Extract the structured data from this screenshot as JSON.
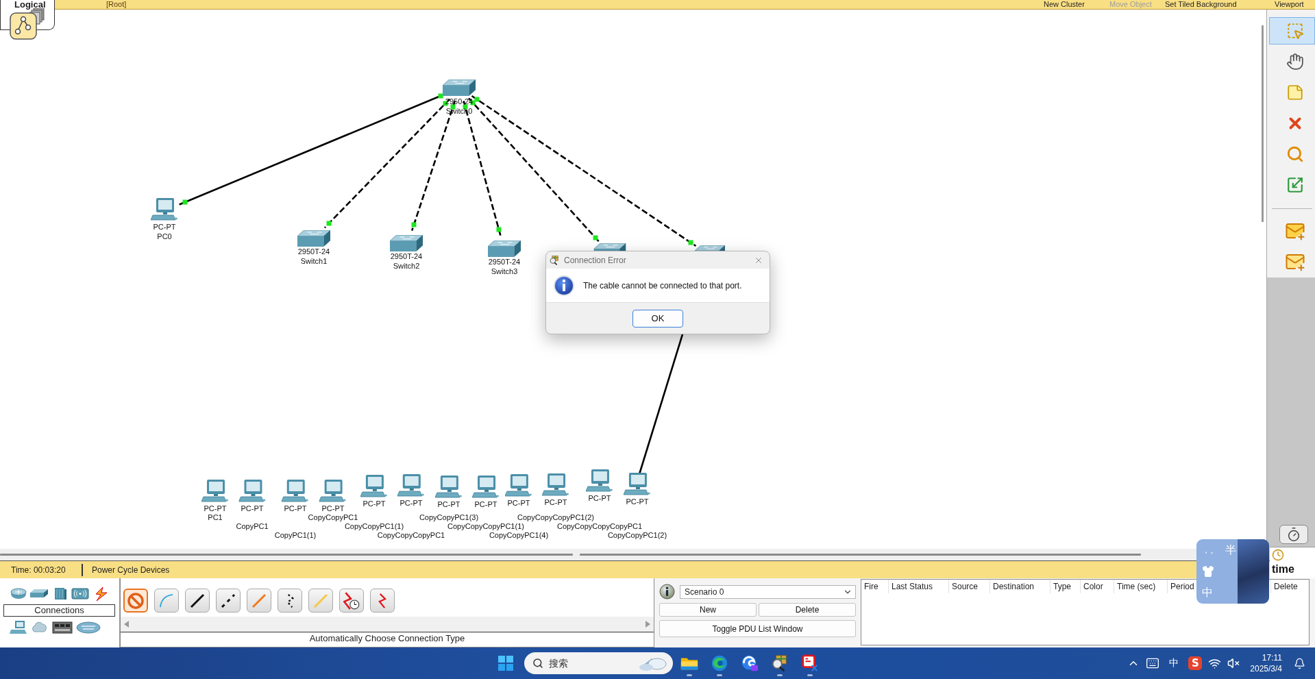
{
  "top_bar": {
    "view_tab": {
      "label": "Logical",
      "selected": true
    },
    "path": "[Root]",
    "actions": [
      {
        "label": "New Cluster",
        "disabled": false
      },
      {
        "label": "Move Object",
        "disabled": true
      },
      {
        "label": "Set Tiled Background",
        "disabled": false
      },
      {
        "label": "Viewport",
        "disabled": false
      }
    ]
  },
  "devices": [
    {
      "kind": "switch",
      "model": "2950-24",
      "name": "Switch0"
    },
    {
      "kind": "pc",
      "model": "PC-PT",
      "name": "PC0"
    },
    {
      "kind": "switch",
      "model": "2950T-24",
      "name": "Switch1"
    },
    {
      "kind": "switch",
      "model": "2950T-24",
      "name": "Switch2"
    },
    {
      "kind": "switch",
      "model": "2950T-24",
      "name": "Switch3"
    },
    {
      "kind": "switch"
    },
    {
      "kind": "switch"
    },
    {
      "kind": "pc",
      "model": "PC-PT",
      "name": "PC1"
    },
    {
      "kind": "pc",
      "model": "PC-PT",
      "name": "CopyPC1"
    },
    {
      "kind": "pc",
      "model": "PC-PT",
      "name": "CopyPC1(1)"
    },
    {
      "kind": "pc",
      "model": "PC-PT",
      "name": "CopyCopyPC1"
    },
    {
      "kind": "pc",
      "model": "PC-PT",
      "name": "CopyCopyPC1(1)"
    },
    {
      "kind": "pc",
      "model": "PC-PT",
      "name": "CopyCopyCopyPC1"
    },
    {
      "kind": "pc",
      "model": "PC-PT",
      "name": "CopyCopyPC1(3)"
    },
    {
      "kind": "pc",
      "model": "PC-PT",
      "name": "CopyCopyCopyPC1(1)"
    },
    {
      "kind": "pc",
      "model": "PC-PT",
      "name": "CopyCopyPC1(4)"
    },
    {
      "kind": "pc",
      "model": "PC-PT",
      "name": "CopyCopyCopyPC1(2)"
    },
    {
      "kind": "pc",
      "model": "PC-PT",
      "name": "CopyCopyCopyCopyPC1"
    },
    {
      "kind": "pc",
      "model": "PC-PT",
      "name": "CopyCopyPC1(2)"
    }
  ],
  "cables": [
    {
      "kind": "straight",
      "link_up": true
    },
    {
      "kind": "cross",
      "link_up": true
    },
    {
      "kind": "cross",
      "link_up": true
    },
    {
      "kind": "cross",
      "link_up": true
    },
    {
      "kind": "cross",
      "link_up": true
    },
    {
      "kind": "cross",
      "link_up": true
    },
    {
      "kind": "straight",
      "link_up": false
    }
  ],
  "dialog": {
    "title": "Connection Error",
    "message": "The cable cannot be connected to that port.",
    "button": "OK"
  },
  "right_toolbar": {
    "tools": [
      {
        "kind": "select",
        "selected": true
      },
      {
        "kind": "move",
        "selected": false
      },
      {
        "kind": "note",
        "selected": false
      },
      {
        "kind": "delete",
        "selected": false
      },
      {
        "kind": "inspect",
        "selected": false
      },
      {
        "kind": "resize",
        "selected": false
      }
    ],
    "pdu_tools": [
      {
        "kind": "simple-pdu",
        "selected": false
      },
      {
        "kind": "complex-pdu",
        "selected": false
      }
    ]
  },
  "status_bar": {
    "time": "Time: 00:03:20",
    "action": "Power Cycle Devices",
    "mode_tab": "time"
  },
  "device_panel": {
    "category_label": "Connections"
  },
  "connection_panel": {
    "types": [
      {
        "kind": "auto",
        "selected": true
      },
      {
        "kind": "console",
        "selected": false
      },
      {
        "kind": "straight",
        "selected": false
      },
      {
        "kind": "cross",
        "selected": false
      },
      {
        "kind": "fiber",
        "selected": false
      },
      {
        "kind": "phone",
        "selected": false
      },
      {
        "kind": "coaxial",
        "selected": false
      },
      {
        "kind": "serial-dce",
        "selected": false
      },
      {
        "kind": "serial-dte",
        "selected": false
      }
    ],
    "description": "Automatically Choose Connection Type"
  },
  "scenario_panel": {
    "scenario": "Scenario 0",
    "buttons": [
      "New",
      "Delete"
    ],
    "toggle_button": "Toggle PDU List Window"
  },
  "pdu_table": {
    "columns": [
      "Fire",
      "Last Status",
      "Source",
      "Destination",
      "Type",
      "Color",
      "Time (sec)",
      "Period",
      "Delete"
    ]
  },
  "ime_toolbar": {
    "punctuation": "，。",
    "width_mode": "半",
    "language": "中"
  },
  "taskbar": {
    "search": {
      "placeholder": "搜索"
    },
    "apps": [
      {
        "kind": "folder",
        "running": true
      },
      {
        "kind": "edge",
        "running": true
      },
      {
        "kind": "edge-ai",
        "running": false
      },
      {
        "kind": "packet-tracer",
        "running": true
      },
      {
        "kind": "snipping",
        "running": true
      }
    ],
    "tray": {
      "ime_mode": "中",
      "ime_logo": "S",
      "time": "17:11",
      "date": "2025/3/4"
    }
  }
}
